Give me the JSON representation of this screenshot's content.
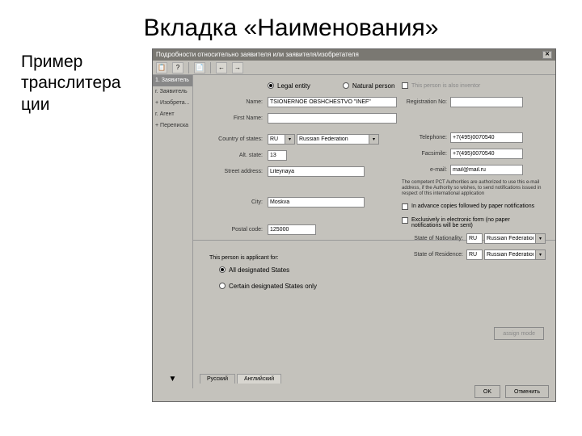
{
  "slide": {
    "title": "Вкладка «Наименования»",
    "side_text": "Пример транслитера ции"
  },
  "window": {
    "title": "Подробности относительно заявителя или заявителя/изобретателя"
  },
  "toolbar": {
    "icons": [
      "📋",
      "?",
      "📄",
      "←",
      "→"
    ]
  },
  "sidebar": {
    "items": [
      {
        "label": "1. Заявитель",
        "active": true
      },
      {
        "label": "г. Заявитель"
      },
      {
        "label": "+ Изобрета..."
      },
      {
        "label": "г. Агент"
      },
      {
        "label": "+ Переписка"
      }
    ]
  },
  "form": {
    "entity_legal": "Legal entity",
    "entity_natural": "Natural person",
    "inventor_chk": "This person is also inventor",
    "name_label": "Name:",
    "name_value": "TSIONERNOE OBSHCHESTVO \"INEF\"",
    "firstname_label": "First Name:",
    "regno_label": "Registration No:",
    "country_label": "Country of states:",
    "country_code": "RU",
    "country_name": "Russian Federation",
    "altstate_label": "Alt. state:",
    "altstate_value": "13",
    "street_label": "Street address:",
    "street_value": "Liteynaya",
    "city_label": "City:",
    "city_value": "Moskva",
    "postal_label": "Postal code:",
    "postal_value": "125000",
    "tel_label": "Telephone:",
    "tel_value": "+7(495)0070540",
    "fax_label": "Facsimile:",
    "fax_value": "+7(495)0070540",
    "email_label": "e-mail:",
    "email_value": "mail@mail.ru",
    "info1": "The competent PCT Authorities are authorized to use this e-mail address, if the Authority so wishes, to send notifications issued in respect of this international application",
    "chk_advance": "In advance copies followed by paper notifications",
    "chk_exclusive": "Exclusively in electronic form (no paper notifications will be sent)",
    "nat_label": "State of Nationality:",
    "nat_code": "RU",
    "nat_name": "Russian Federation",
    "res_label": "State of Residence:",
    "res_code": "RU",
    "res_name": "Russian Federation",
    "applicant_for": "This person is applicant for:",
    "all_states": "All designated States",
    "certain_states": "Certain designated States only",
    "assign_btn": "assign mode",
    "tab_ru": "Русский",
    "tab_en": "Английский",
    "ok": "OK",
    "cancel": "Отменить"
  }
}
